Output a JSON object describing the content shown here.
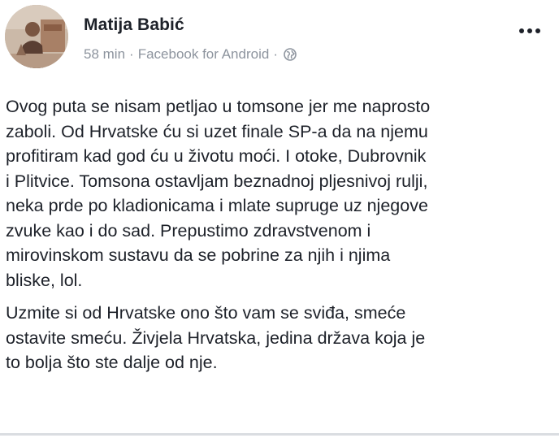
{
  "post": {
    "author": "Matija Babić",
    "time": "58 min",
    "separator": "·",
    "source": "Facebook for Android",
    "privacy_icon": "globe-icon",
    "paragraph1_lines": [
      "Ovog puta se nisam petljao u tomsone jer me naprosto",
      "zaboli. Od Hrvatske ću si uzet finale SP-a da na njemu",
      "profitiram kad god ću u životu moći. I otoke, Dubrovnik",
      "i Plitvice. Tomsona ostavljam beznadnoj pljesnivoj rulji,",
      "neka prde po kladionicama i mlate supruge uz njegove",
      "zvuke kao i do sad. Prepustimo zdravstvenom i",
      "mirovinskom sustavu da se pobrine za njih i njima",
      "bliske, lol."
    ],
    "paragraph2_lines": [
      "Uzmite si od Hrvatske ono što vam se sviđa, smeće",
      "ostavite smeću. Živjela Hrvatska, jedina država koja je",
      "to bolja što ste dalje od nje."
    ]
  },
  "colors": {
    "text": "#1d2129",
    "meta": "#8d949e",
    "divider": "#dadde1",
    "background": "#ffffff"
  },
  "icons": {
    "more": "more-options-icon",
    "avatar": "profile-avatar"
  }
}
